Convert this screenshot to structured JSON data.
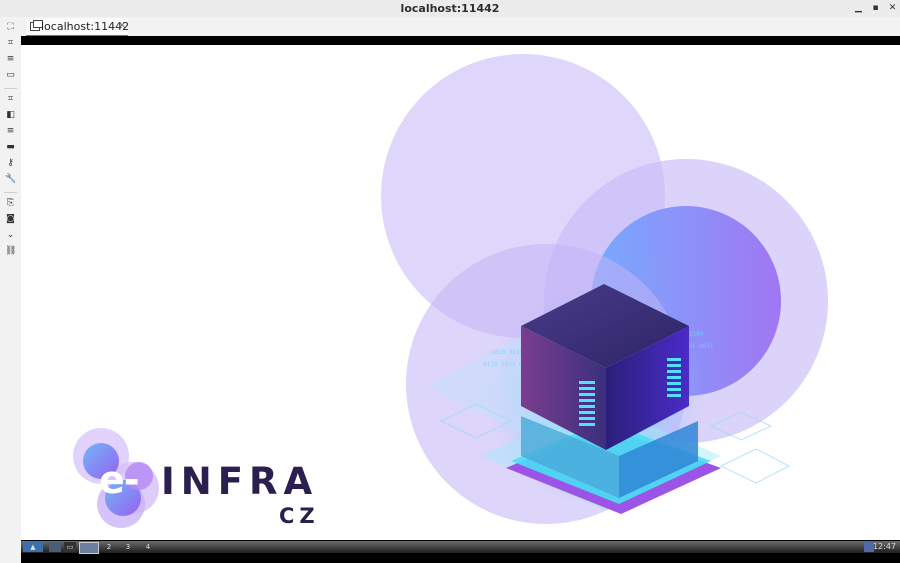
{
  "window": {
    "title": "localhost:11442"
  },
  "tab": {
    "label": "localhost:11442",
    "close": "×"
  },
  "brand": {
    "e": "e-",
    "infra": "INFRA",
    "country": "CZ"
  },
  "taskbar": {
    "workspaces": [
      "2",
      "3",
      "4"
    ],
    "clock": "12:47"
  },
  "sidebar_icons": [
    "fit-icon",
    "fullscreen-icon",
    "menu-icon",
    "window-icon",
    "scale-icon",
    "resize-icon",
    "list-icon",
    "keyboard-icon",
    "keys-icon",
    "wrench-icon",
    "clipboard-icon",
    "camera-icon",
    "chevron-down-icon",
    "link-icon"
  ],
  "colors": {
    "accent": "#3b7ddd",
    "brand_dark": "#2a1f4f",
    "lavender": "#d9d1fb",
    "cyan": "#3fe6f0"
  }
}
